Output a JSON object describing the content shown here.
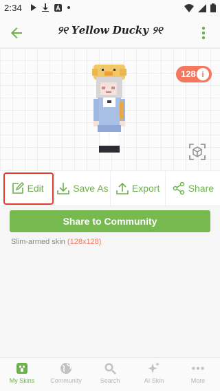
{
  "status_bar": {
    "time": "2:34",
    "icons": [
      "play-icon",
      "download-icon",
      "a-badge-icon",
      "dot-icon",
      "wifi-icon",
      "signal-icon",
      "battery-icon"
    ]
  },
  "appbar": {
    "title": "୨୧ 𝒀𝒆𝒍𝒍𝒐𝒘 𝑫𝒖𝒄𝒌𝒚 ୨୧",
    "accent": "#6cb24b"
  },
  "preview": {
    "resolution_badge": "128",
    "badge_color": "#f5775e"
  },
  "actions": [
    {
      "label": "Edit",
      "icon": "edit-icon"
    },
    {
      "label": "Save As",
      "icon": "download-icon"
    },
    {
      "label": "Export",
      "icon": "export-icon"
    },
    {
      "label": "Share",
      "icon": "share-icon"
    }
  ],
  "share_community_label": "Share to Community",
  "skin_info": {
    "label": "Slim-armed skin",
    "size": "(128x128)"
  },
  "bottom_nav": [
    {
      "label": "My Skins",
      "icon": "my-skins-icon",
      "active": true
    },
    {
      "label": "Community",
      "icon": "globe-icon",
      "active": false
    },
    {
      "label": "Search",
      "icon": "search-icon",
      "active": false
    },
    {
      "label": "AI Skin",
      "icon": "sparkle-icon",
      "active": false
    },
    {
      "label": "More",
      "icon": "more-dots-icon",
      "active": false
    }
  ]
}
